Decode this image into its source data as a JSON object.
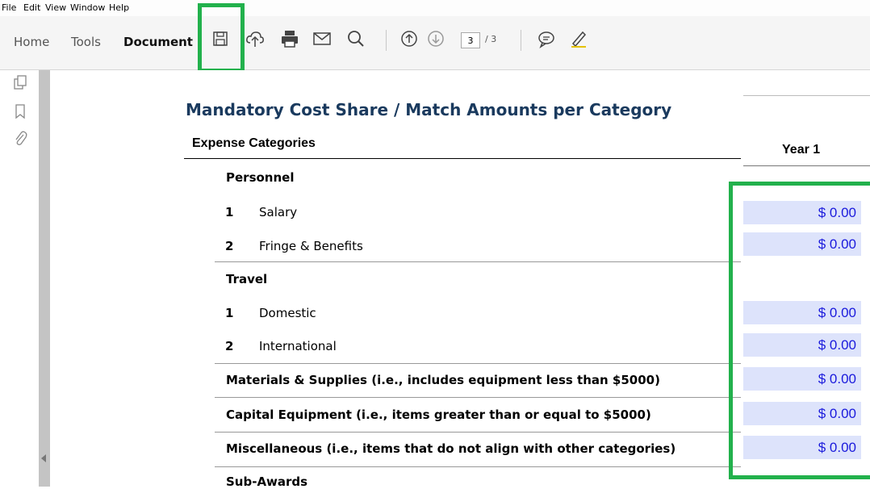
{
  "menu": {
    "items": [
      "File",
      "Edit",
      "View",
      "Window",
      "Help"
    ]
  },
  "toolbar": {
    "tabs": [
      "Home",
      "Tools",
      "Document"
    ],
    "active_tab": "Document",
    "icons": [
      "save-icon",
      "upload-cloud-icon",
      "print-icon",
      "email-icon",
      "search-icon",
      "page-up-icon",
      "page-down-icon",
      "comment-icon",
      "highlight-pen-icon"
    ],
    "current_page": "3",
    "total_pages": "/ 3"
  },
  "leftnav": {
    "icons": [
      "pages-icon",
      "bookmark-icon",
      "attachment-icon"
    ]
  },
  "form": {
    "title": "Mandatory Cost Share / Match Amounts per Category",
    "expense_header": "Expense Categories",
    "year_header": "Year 1",
    "rows": [
      {
        "num": "",
        "label": "Personnel",
        "value": ""
      },
      {
        "num": "1",
        "label": "Salary",
        "value": "$ 0.00"
      },
      {
        "num": "2",
        "label": "Fringe & Benefits",
        "value": "$ 0.00"
      },
      {
        "num": "",
        "label": "Travel",
        "value": ""
      },
      {
        "num": "1",
        "label": "Domestic",
        "value": "$ 0.00"
      },
      {
        "num": "2",
        "label": "International",
        "value": "$ 0.00"
      },
      {
        "num": "",
        "label": "Materials & Supplies (i.e., includes equipment less than $5000)",
        "value": "$ 0.00"
      },
      {
        "num": "",
        "label": "Capital Equipment (i.e., items greater than or equal to $5000)",
        "value": "$ 0.00"
      },
      {
        "num": "",
        "label": "Miscellaneous (i.e., items that do not align with other categories)",
        "value": "$ 0.00"
      },
      {
        "num": "",
        "label": "Sub-Awards",
        "value": ""
      }
    ]
  },
  "colors": {
    "highlight": "#22b14c",
    "field_bg": "#dde3fb",
    "field_text": "#1a1adc",
    "title": "#1a3a5e"
  }
}
